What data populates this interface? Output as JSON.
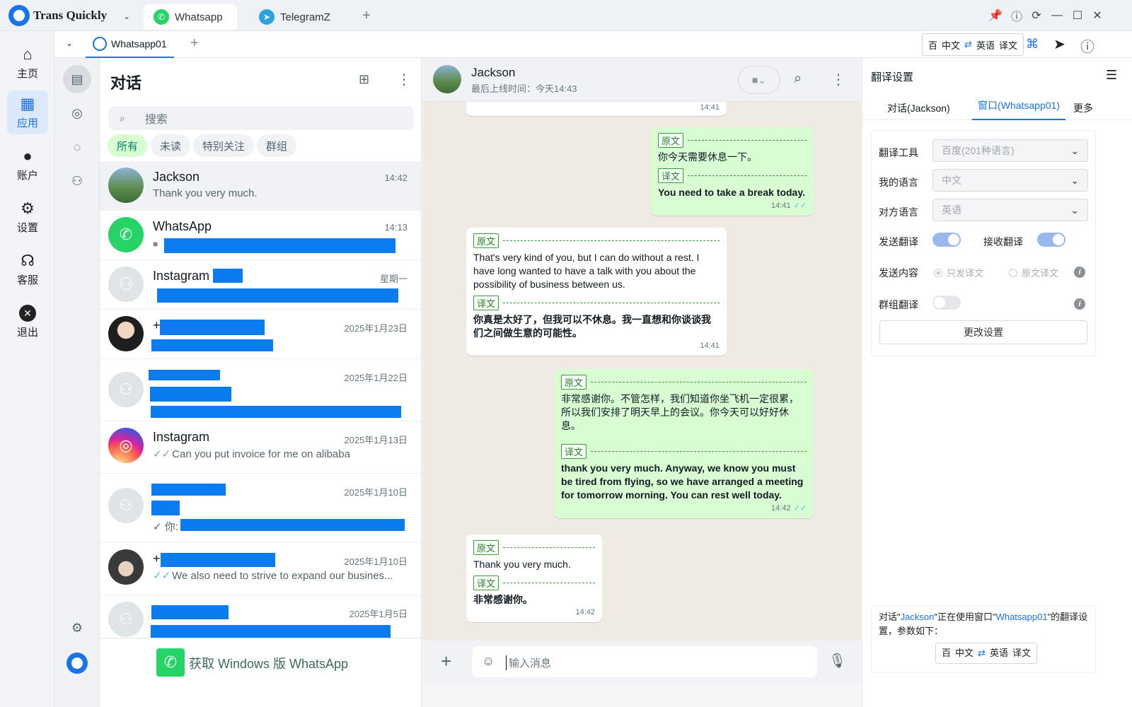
{
  "app": {
    "brand": "Trans Quickly",
    "tabs": [
      {
        "label": "Whatsapp"
      },
      {
        "label": "TelegramZ"
      }
    ],
    "subtab": "Whatsapp01",
    "trans_pill": {
      "engine": "百",
      "src": "中文",
      "dst": "英语",
      "action": "译文"
    }
  },
  "leftnav": {
    "items": [
      {
        "label": "主页"
      },
      {
        "label": "应用"
      },
      {
        "label": "账户"
      },
      {
        "label": "设置"
      },
      {
        "label": "客服"
      },
      {
        "label": "退出"
      }
    ]
  },
  "chatlist": {
    "title": "对话",
    "search_placeholder": "搜索",
    "chips": [
      "所有",
      "未读",
      "特别关注",
      "群组"
    ],
    "rows": [
      {
        "name": "Jackson",
        "time": "14:42",
        "msg": "Thank you very much."
      },
      {
        "name": "WhatsApp",
        "time": "14:13",
        "msg": ""
      },
      {
        "name": "Instagram",
        "time": "星期一",
        "msg": ""
      },
      {
        "name": "+",
        "time": "2025年1月23日",
        "msg": ""
      },
      {
        "name": "",
        "time": "2025年1月22日",
        "msg": ""
      },
      {
        "name": "Instagram",
        "time": "2025年1月13日",
        "msg": "Can you put invoice for me on alibaba"
      },
      {
        "name": "",
        "time": "2025年1月10日",
        "msg": "你:"
      },
      {
        "name": "+",
        "time": "2025年1月10日",
        "msg": "We also need to strive to expand our busines..."
      },
      {
        "name": "",
        "time": "2025年1月5日",
        "msg": ""
      }
    ],
    "footer": "获取 Windows 版 WhatsApp"
  },
  "chat": {
    "name": "Jackson",
    "status": "最后上线时间：今天14:43",
    "tag_orig": "原文",
    "tag_trans": "译文",
    "top_time": "14:41",
    "messages": [
      {
        "dir": "out",
        "orig": "你今天需要休息一下。",
        "trans": "You need to take a break today.",
        "time": "14:41"
      },
      {
        "dir": "in",
        "orig": "That's very kind of you, but I can do without a rest. I have long wanted to have a talk with you about the possibility of business between us.",
        "trans": "你真是太好了，但我可以不休息。我一直想和你谈谈我们之间做生意的可能性。",
        "time": "14:41"
      },
      {
        "dir": "out",
        "orig": "非常感谢你。不管怎样，我们知道你坐飞机一定很累，所以我们安排了明天早上的会议。你今天可以好好休息。",
        "trans": "thank you very much. Anyway, we know you must be tired from flying, so we have arranged a meeting for tomorrow morning. You can rest well today.",
        "time": "14:42"
      },
      {
        "dir": "in",
        "orig": "Thank you very much.",
        "trans": "非常感谢你。",
        "time": "14:42"
      }
    ],
    "input_placeholder": "输入消息"
  },
  "settings": {
    "title": "翻译设置",
    "tabs": [
      "对话(Jackson)",
      "窗口(Whatsapp01)",
      "更多"
    ],
    "tool_label": "翻译工具",
    "tool_value": "百度(201种语言)",
    "my_lang_label": "我的语言",
    "my_lang_value": "中文",
    "their_lang_label": "对方语言",
    "their_lang_value": "英语",
    "send_label": "发送翻译",
    "recv_label": "接收翻译",
    "content_label": "发送内容",
    "opt_only": "只发译文",
    "opt_both": "原文译文",
    "group_label": "群组翻译",
    "change_btn": "更改设置",
    "note_pre": "对话\"",
    "note_name": "Jackson",
    "note_mid": "\"正在使用窗口\"",
    "note_win": "Whatsapp01",
    "note_post": "\"的翻译设置，参数如下：",
    "send_on": true,
    "recv_on": true,
    "group_on": false
  },
  "colors": {
    "accent": "#1a73e8",
    "wa_green": "#25d366",
    "redact": "#0a7cf0"
  }
}
